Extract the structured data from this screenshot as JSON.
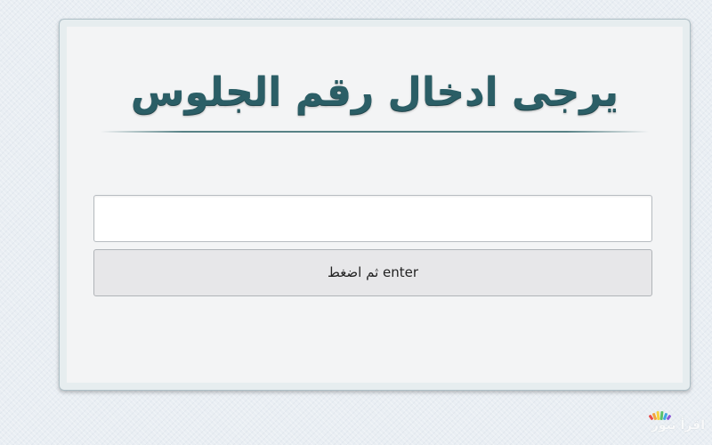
{
  "page": {
    "title": "يرجى ادخال رقم الجلوس"
  },
  "form": {
    "seat_input_value": "",
    "submit_label": "ثم اضغط enter"
  },
  "watermark": {
    "text": "اقرأ بنور",
    "icon": "open-book-icon"
  },
  "colors": {
    "title": "#2b5e66",
    "divider": "#3c6e73",
    "card_background": "#f3f4f5",
    "button_background": "#e7e7e9"
  }
}
